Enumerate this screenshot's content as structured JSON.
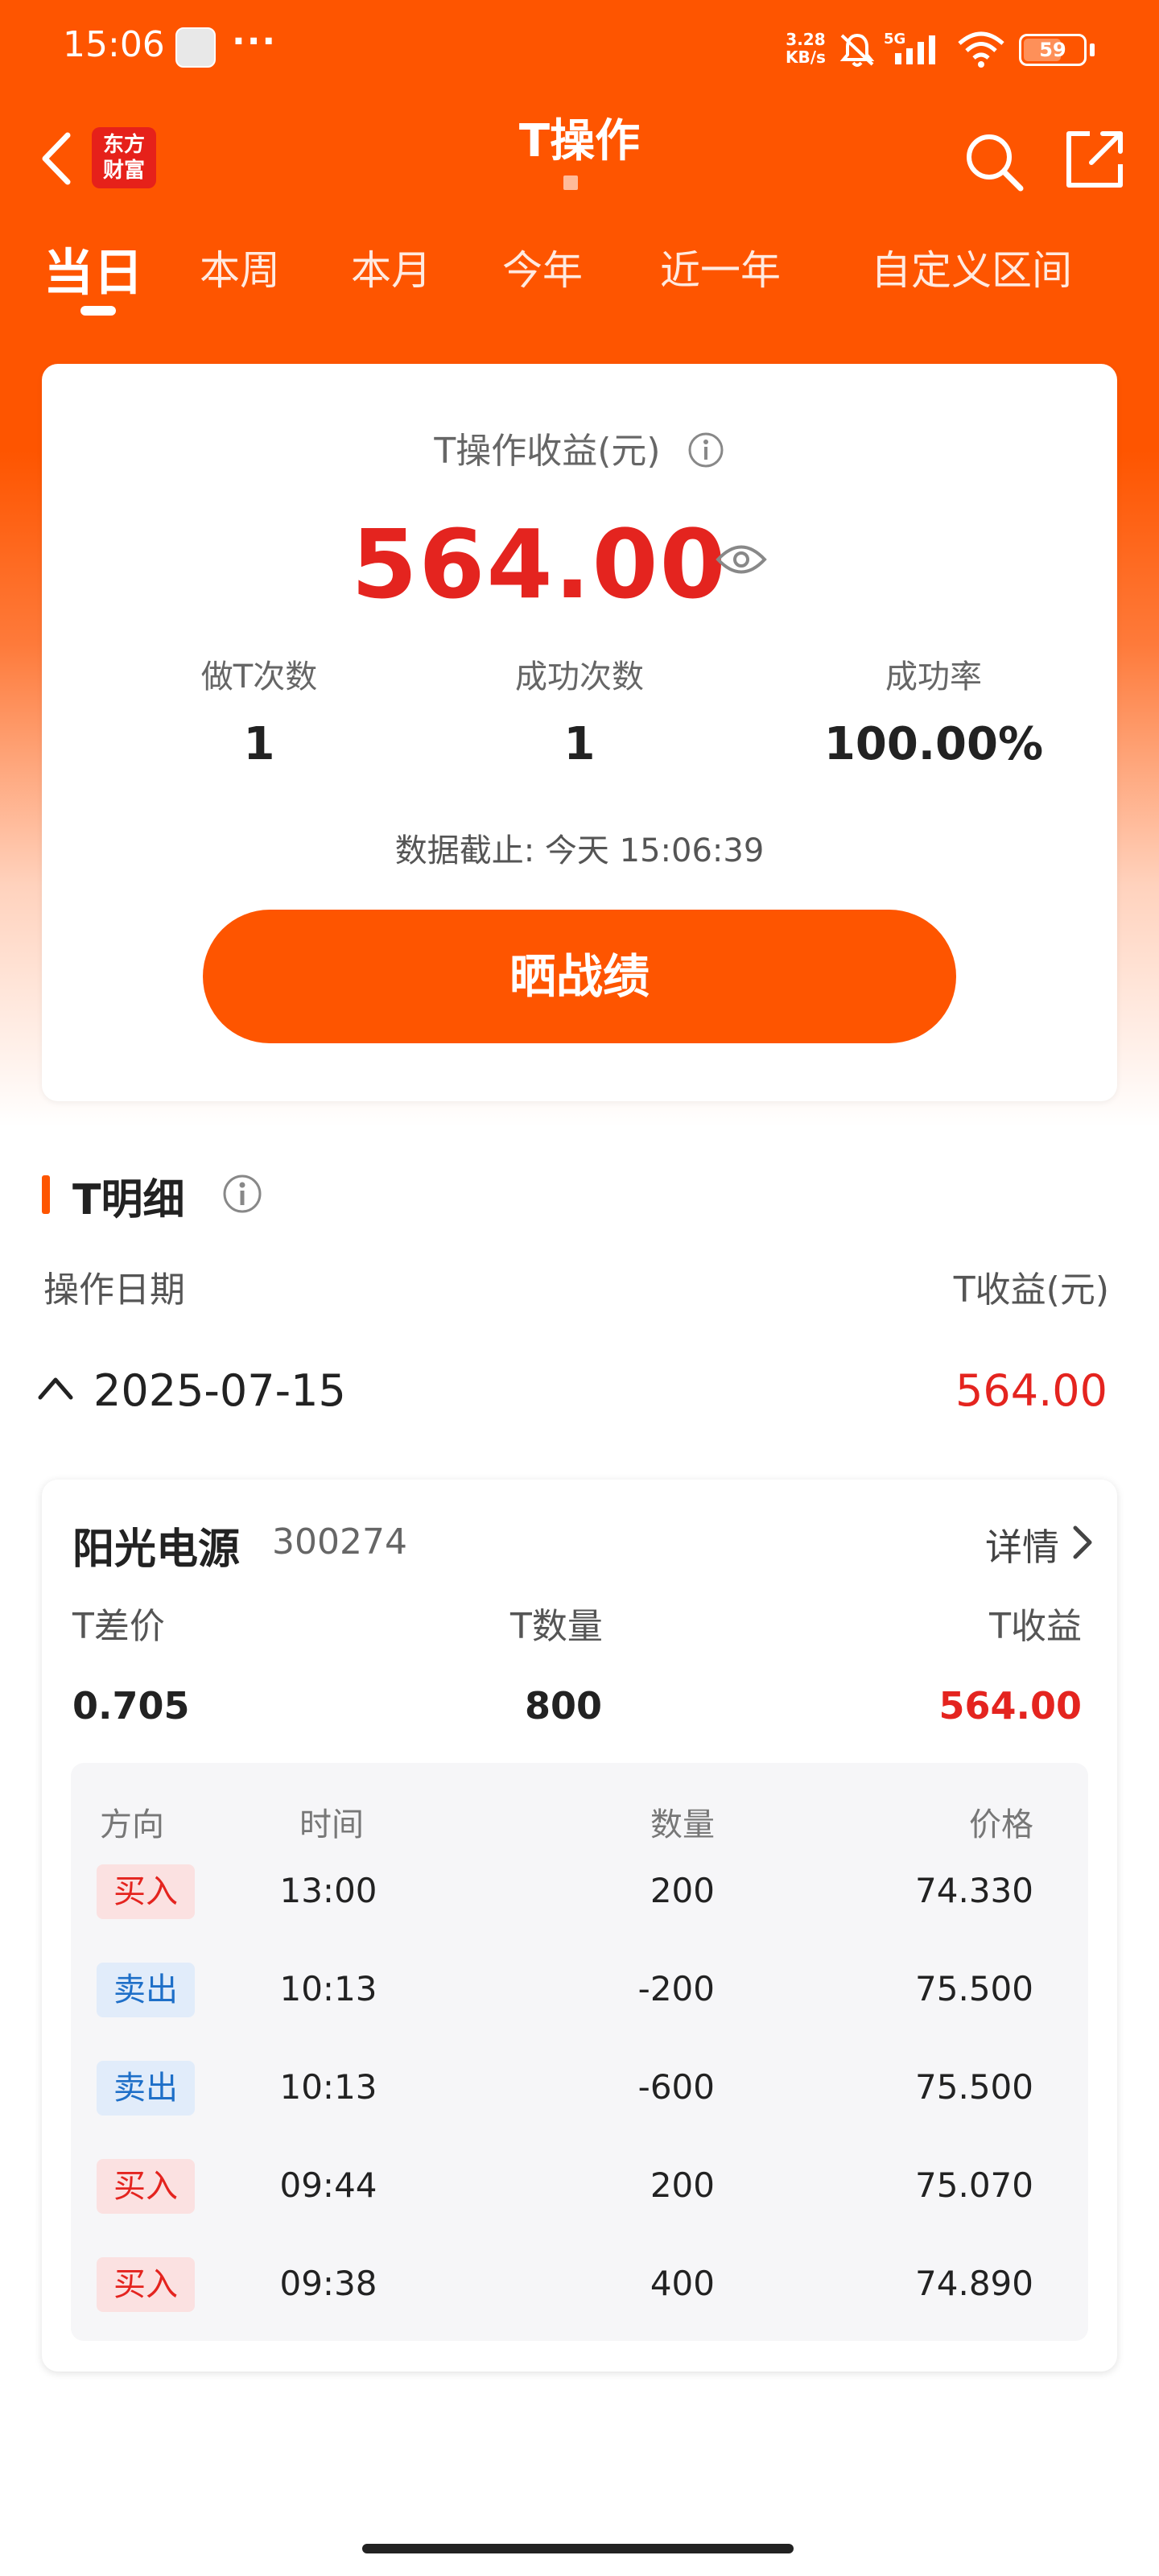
{
  "status_bar": {
    "time": "15:06",
    "dots": "···",
    "net_speed_value": "3.28",
    "net_speed_unit": "KB/s",
    "network": "5G",
    "battery": "59"
  },
  "nav": {
    "logo_line1": "东方",
    "logo_line2": "财富",
    "title": "T操作"
  },
  "tabs": [
    {
      "label": "当日",
      "active": true
    },
    {
      "label": "本周",
      "active": false
    },
    {
      "label": "本月",
      "active": false
    },
    {
      "label": "今年",
      "active": false
    },
    {
      "label": "近一年",
      "active": false
    },
    {
      "label": "自定义区间",
      "active": false
    }
  ],
  "summary": {
    "profit_label": "T操作收益(元)",
    "profit_value": "564.00",
    "stats": [
      {
        "label": "做T次数",
        "value": "1"
      },
      {
        "label": "成功次数",
        "value": "1"
      },
      {
        "label": "成功率",
        "value": "100.00%"
      }
    ],
    "data_as_of": "数据截止: 今天 15:06:39",
    "share_button": "晒战绩"
  },
  "detail": {
    "section_title": "T明细",
    "col_date": "操作日期",
    "col_profit": "T收益(元)",
    "date": "2025-07-15",
    "date_profit": "564.00",
    "stock": {
      "name": "阳光电源",
      "code": "300274",
      "detail_link": "详情",
      "metrics": [
        {
          "label": "T差价",
          "value": "0.705"
        },
        {
          "label": "T数量",
          "value": "800"
        },
        {
          "label": "T收益",
          "value": "564.00"
        }
      ],
      "trade_headers": {
        "direction": "方向",
        "time": "时间",
        "quantity": "数量",
        "price": "价格"
      },
      "trades": [
        {
          "direction": "买入",
          "type": "buy",
          "time": "13:00",
          "quantity": "200",
          "price": "74.330"
        },
        {
          "direction": "卖出",
          "type": "sell",
          "time": "10:13",
          "quantity": "-200",
          "price": "75.500"
        },
        {
          "direction": "卖出",
          "type": "sell",
          "time": "10:13",
          "quantity": "-600",
          "price": "75.500"
        },
        {
          "direction": "买入",
          "type": "buy",
          "time": "09:44",
          "quantity": "200",
          "price": "75.070"
        },
        {
          "direction": "买入",
          "type": "buy",
          "time": "09:38",
          "quantity": "400",
          "price": "74.890"
        }
      ]
    }
  },
  "colors": {
    "brand": "#fe5500",
    "profit_red": "#e4241f",
    "sell_blue": "#1e6fc8"
  }
}
